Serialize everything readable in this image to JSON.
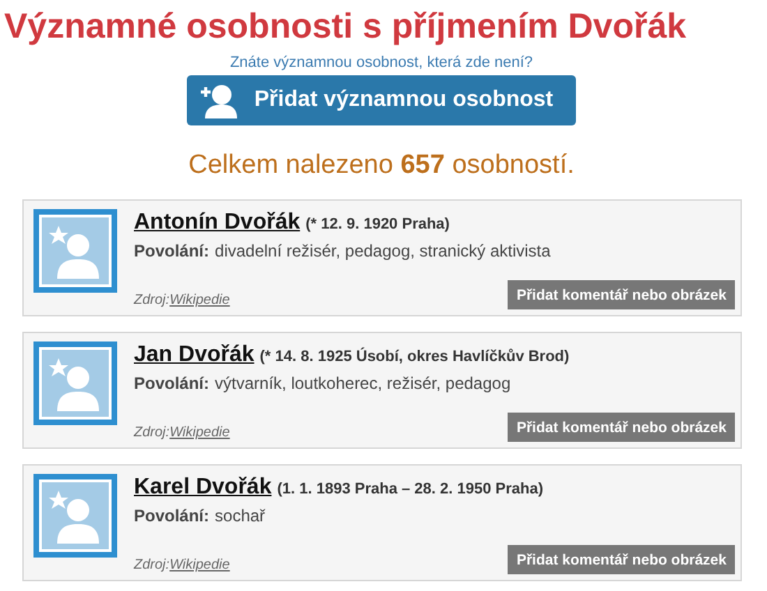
{
  "page_title": "Významné osobnosti s příjmením Dvořák",
  "add_hint": "Znáte významnou osobnost, která zde není?",
  "add_button": "Přidat významnou osobnost",
  "result_count": "Celkem nalezeno **657** osobností.",
  "people": [
    {
      "name": "Antonín Dvořák",
      "dates": "(* 12. 9. 1920 Praha)",
      "occupation_label": "Povolání:",
      "occupation": "divadelní režisér, pedagog, stranický aktivista",
      "source_label": "Zdroj:",
      "source_link": "Wikipedie",
      "comment_button": "Přidat komentář nebo obrázek"
    },
    {
      "name": "Jan Dvořák",
      "dates": "(* 14. 8. 1925 Úsobí, okres Havlíčkův Brod)",
      "occupation_label": "Povolání:",
      "occupation": "výtvarník, loutkoherec, režisér, pedagog",
      "source_label": "Zdroj:",
      "source_link": "Wikipedie",
      "comment_button": "Přidat komentář nebo obrázek"
    },
    {
      "name": "Karel Dvořák",
      "dates": "(1. 1. 1893 Praha – 28. 2. 1950 Praha)",
      "occupation_label": "Povolání:",
      "occupation": "sochař",
      "source_label": "Zdroj:",
      "source_link": "Wikipedie",
      "comment_button": "Přidat komentář nebo obrázek"
    }
  ]
}
